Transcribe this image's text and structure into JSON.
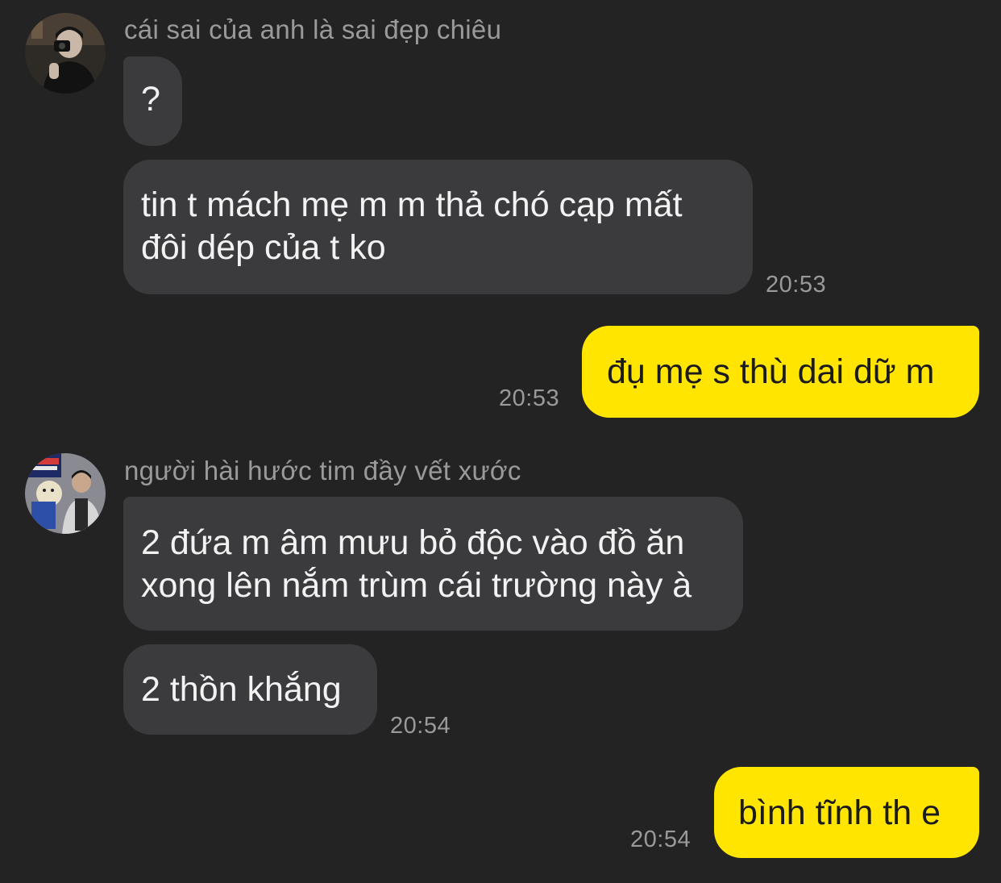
{
  "messages": {
    "group1": {
      "sender_name": "cái sai của anh là sai đẹp chiêu",
      "bubble1": "?",
      "bubble2": "tin t mách mẹ m m thả chó cạp mất đôi dép của t ko",
      "time": "20:53"
    },
    "out1": {
      "text": "đụ mẹ s thù dai dữ m",
      "time": "20:53"
    },
    "group2": {
      "sender_name": "người hài hước tim đầy vết xước",
      "bubble1": "2 đứa m âm mưu bỏ độc vào đồ ăn xong lên nắm trùm cái trường này à",
      "bubble2": "2 thồn khắng",
      "time": "20:54"
    },
    "out2": {
      "text": "bình tĩnh th e",
      "time": "20:54"
    }
  },
  "colors": {
    "background": "#232323",
    "incoming_bubble": "#3b3b3d",
    "outgoing_bubble": "#ffe500",
    "meta_text": "#9a9a9a"
  },
  "icons": {
    "avatar1": "profile-photo-person-with-camera",
    "avatar2": "profile-photo-person-with-plush-toy"
  }
}
